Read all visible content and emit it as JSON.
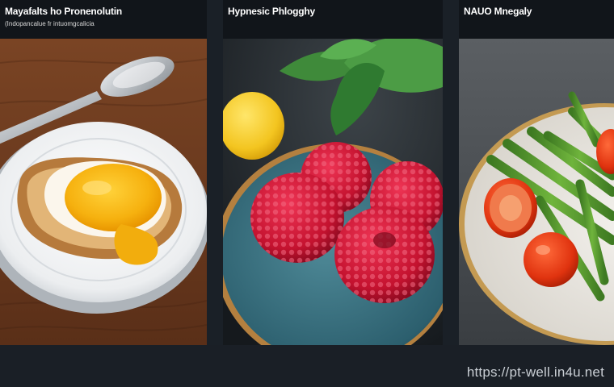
{
  "panels": [
    {
      "title": "Mayafalts ho Pronenolutin",
      "subtitle": "(Indopancalue fr intuomgcalicia"
    },
    {
      "title": "Hypnesic Phlogghy"
    },
    {
      "title": "NAUO Mnegaly"
    }
  ],
  "watermark": "https://pt-well.in4u.net"
}
